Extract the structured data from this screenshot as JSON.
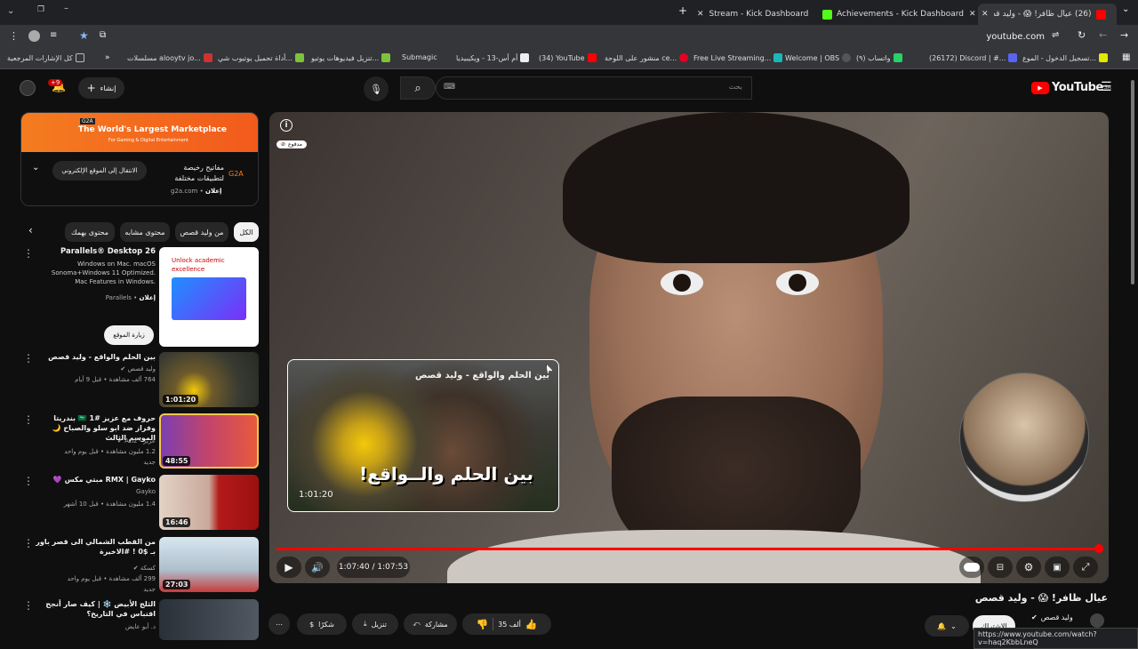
{
  "tabs": [
    {
      "title": "(26) عيال ظافر! 😱 - وليد قصص",
      "active": true,
      "color": "#ff0000"
    },
    {
      "title": "Achievements - Kick Dashboard",
      "active": false,
      "color": "#53fc18"
    },
    {
      "title": "Stream - Kick Dashboard",
      "active": false,
      "color": "#53fc18"
    }
  ],
  "address": {
    "url": "youtube.com"
  },
  "bookmarks": [
    {
      "label": "تسجيل الدخول - الموع...",
      "color": "#e3e800"
    },
    {
      "label": "(26172) Discord | #...",
      "color": "#5865f2"
    },
    {
      "label": "(٩) واتساب",
      "color": "#25d366"
    },
    {
      "label": "Welcome | OBS",
      "color": "#555"
    },
    {
      "label": "Free Live Streaming...",
      "color": "#1ab8b8"
    },
    {
      "label": "منشور على اللوحة ce...",
      "color": "#e60023"
    },
    {
      "label": "(34) YouTube",
      "color": "#ff0000"
    },
    {
      "label": "أم أس-13 - ويكيبيديا",
      "color": "#eee"
    },
    {
      "label": "Submagic",
      "color": "#ffcc00"
    },
    {
      "label": "تنزيل فيديوهات يوتيو...",
      "color": "#7ec23c"
    },
    {
      "label": "أداة تحميل يوتيوب شي...",
      "color": "#7ec23c"
    },
    {
      "label": "مسلسلات alooytv jo...",
      "color": "#cc3333"
    },
    {
      "label": "كل الإشارات المرجعية",
      "color": "#bbb"
    }
  ],
  "header": {
    "logo": "YouTube",
    "region": "SA",
    "search_placeholder": "بحث",
    "create_label": "إنشاء",
    "notif_count": "+9"
  },
  "sidebar_ad": {
    "banner_title": "The World's Largest Marketplace",
    "banner_sub": "For Gaming & Digital Entertainment",
    "title": "مفاتيح رخيصة لتطبيقات مختلفة",
    "sponsor": "إعلان",
    "domain": "g2a.com",
    "cta": "الانتقال إلى الموقع الإلكتروني"
  },
  "chips": [
    "الكل",
    "من وليد قصص",
    "محتوى مشابه",
    "محتوى يهمك"
  ],
  "promoted": {
    "title": "Parallels® Desktop 26",
    "desc": "Windows on Mac. macOS Sonoma+Windows 11 Optimized. Mac Features in Windows.",
    "sponsor": "إعلان",
    "brand": "Parallels",
    "cta": "زيارة الموقع",
    "thumb_title": "Unlock academic excellence"
  },
  "related": [
    {
      "title": "بين الحلم والواقع - وليد قصص",
      "channel": "وليد قصص",
      "meta": "764 ألف مشاهدة • قبل 9 أيام",
      "duration": "1:01:20",
      "badge": ""
    },
    {
      "title": "حروف مع عزيز #1 🇸🇦 بندريتا وفراز ضد ابو سلو والصباح 🌙 الموسم الثالث",
      "channel": "عزيز - Aziz",
      "meta": "1.2 مليون مشاهدة • قبل يوم واحد",
      "duration": "48:55",
      "badge": "جديد"
    },
    {
      "title": "💜 مبتي مكس RMX | Gayko",
      "channel": "Gayko",
      "meta": "1.4 مليون مشاهدة • قبل 10 أشهر",
      "duration": "16:46",
      "badge": ""
    },
    {
      "title": "من القطب الشمالي الى قصر باور بـ $0 ! #الاخيرة",
      "channel": "كسكة",
      "meta": "299 ألف مشاهدة • قبل يوم واحد",
      "duration": "27:03",
      "badge": "جديد"
    },
    {
      "title": "الثلج الأبيض ❄️ | كيف صار أنجح اقتباس في التاريخ؟",
      "channel": "د. أبو عايض",
      "meta": "",
      "duration": "",
      "badge": ""
    }
  ],
  "player": {
    "time": "1:07:40 / 1:07:53",
    "progress_fraction": 0.997,
    "info_label": "مدفوع",
    "preview_title": "بين الحلم والواقع - وليد قصص",
    "preview_text": "بين الحلم والــواقع!",
    "preview_time": "1:01:20"
  },
  "video": {
    "title": "عيال ظافر! 😱 - وليد قصص",
    "channel": "وليد قصص",
    "likes": "35 ألف",
    "share": "مشاركة",
    "download": "تنزيل",
    "thanks": "شكرًا",
    "subscribe": "الاشتراك"
  },
  "status_url": "https://www.youtube.com/watch?v=haq2KbbLneQ"
}
